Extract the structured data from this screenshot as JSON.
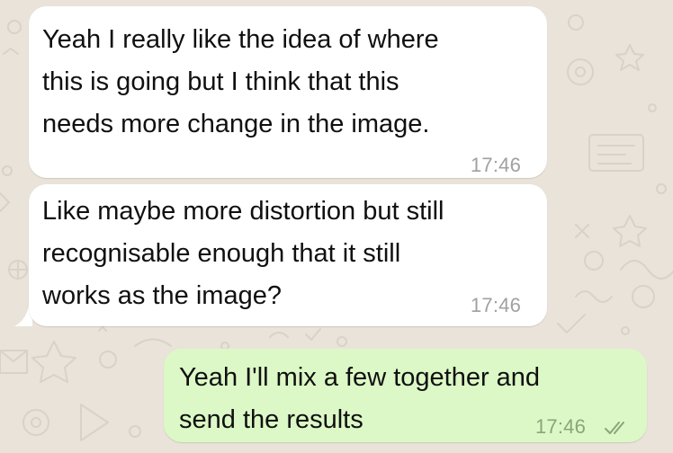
{
  "conversation": {
    "messages": [
      {
        "direction": "incoming",
        "text": "Yeah I really like the idea of where\nthis is going but I think that this\nneeds more change in the image.",
        "time": "17:46"
      },
      {
        "direction": "incoming",
        "text": "Like maybe more distortion but still\nrecognisable enough that it still\nworks as the image?",
        "time": "17:46"
      },
      {
        "direction": "outgoing",
        "text": "Yeah I'll mix a few together and\nsend the results",
        "time": "17:46",
        "status_icon": "double-check-icon"
      }
    ]
  },
  "colors": {
    "wallpaper": "#e9e3da",
    "incoming_bubble": "#ffffff",
    "outgoing_bubble": "#dcf8c6",
    "timestamp": "#a0a0a0",
    "read_ticks": "#8aa57a"
  }
}
